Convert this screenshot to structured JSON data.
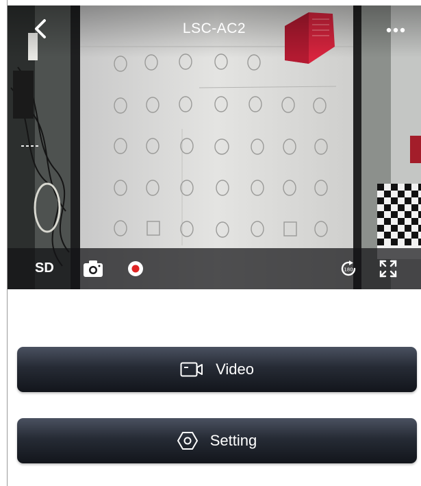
{
  "header": {
    "title": "LSC-AC2",
    "back_icon": "chevron-left-icon",
    "more_icon": "more-horizontal-icon"
  },
  "camera_controls": {
    "quality_label": "SD",
    "snapshot_icon": "camera-icon",
    "record_icon": "record-icon",
    "rotate_icon": "rotate-icon",
    "fullscreen_icon": "fullscreen-icon"
  },
  "actions": [
    {
      "label": "Video",
      "icon": "video-camera-icon"
    },
    {
      "label": "Setting",
      "icon": "hexagon-settings-icon"
    }
  ],
  "colors": {
    "button_gradient_top": "#4a5160",
    "button_gradient_bottom": "#12151b",
    "record_red": "#e02424",
    "laser_head_red": "#d8243e"
  }
}
